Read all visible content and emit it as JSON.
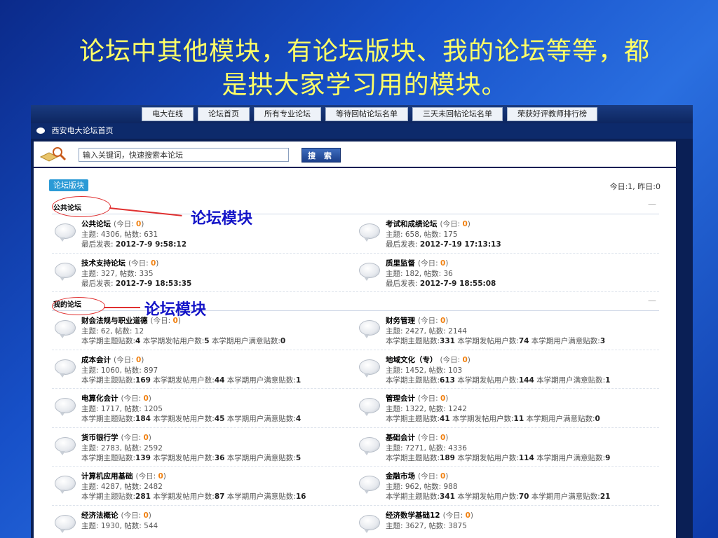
{
  "slide": {
    "title_line1": "论坛中其他模块，有论坛版块、我的论坛等等，都",
    "title_line2": "是拱大家学习用的模块。"
  },
  "nav": {
    "items": [
      "电大在线",
      "论坛首页",
      "所有专业论坛",
      "等待回帖论坛名单",
      "三天未回帖论坛名单",
      "荣获好评教师排行榜"
    ]
  },
  "breadcrumb": "西安电大论坛首页",
  "search": {
    "value": "输入关键词，快速搜索本论坛",
    "button": "搜 索",
    "icon": "magnifier-book-icon"
  },
  "header": {
    "tag": "论坛版块",
    "stats": "今日:1, 昨日:0"
  },
  "annotation": {
    "label1": "论坛模块",
    "label2": "论坛模块",
    "color": "#e03030",
    "text_color": "#1515c8"
  },
  "sections": [
    {
      "name": "公共论坛",
      "collapse": "—",
      "forums": [
        {
          "name": "公共论坛",
          "today_label": "(今日:",
          "today": "0",
          "close": ")",
          "stats": "主题: 4306, 帖数: 631",
          "extra_label": "最后发表: ",
          "extra_value": "2012-7-9 9:58:12"
        },
        {
          "name": "考试和成绩论坛",
          "today_label": "(今日:",
          "today": "0",
          "close": ")",
          "stats": "主题: 658, 帖数: 175",
          "extra_label": "最后发表: ",
          "extra_value": "2012-7-19 17:13:13"
        },
        {
          "name": "技术支持论坛",
          "today_label": "(今日:",
          "today": "0",
          "close": ")",
          "stats": "主题: 327, 帖数: 335",
          "extra_label": "最后发表: ",
          "extra_value": "2012-7-9 18:53:35"
        },
        {
          "name": "质里监督",
          "today_label": "(今日:",
          "today": "0",
          "close": ")",
          "stats": "主题: 182, 帖数: 36",
          "extra_label": "最后发表: ",
          "extra_value": "2012-7-9 18:55:08"
        }
      ]
    },
    {
      "name": "我的论坛",
      "collapse": "—",
      "forums": [
        {
          "name": "财会法规与职业道德",
          "today_label": "(今日:",
          "today": "0",
          "close": ")",
          "stats": "主题: 62, 帖数: 12",
          "extra": "本学期主题贴数:<b>4</b> 本学期发帖用户数:<b>5</b> 本学期用户满意贴数:<b>0</b>"
        },
        {
          "name": "财务管理",
          "today_label": "(今日:",
          "today": "0",
          "close": ")",
          "stats": "主题: 2427, 帖数: 2144",
          "extra": "本学期主题贴数:<b>331</b> 本学期发帖用户数:<b>74</b> 本学期用户满意贴数:<b>3</b>"
        },
        {
          "name": "成本会计",
          "today_label": "(今日:",
          "today": "0",
          "close": ")",
          "stats": "主题: 1060, 帖数: 897",
          "extra": "本学期主题贴数:<b>169</b> 本学期发帖用户数:<b>44</b> 本学期用户满意贴数:<b>1</b>"
        },
        {
          "name": "地域文化（专）",
          "today_label": "(今日:",
          "today": "0",
          "close": ")",
          "stats": "主题: 1452, 帖数: 103",
          "extra": "本学期主题贴数:<b>613</b> 本学期发帖用户数:<b>144</b> 本学期用户满意贴数:<b>1</b>"
        },
        {
          "name": "电算化会计",
          "today_label": "(今日:",
          "today": "0",
          "close": ")",
          "stats": "主题: 1717, 帖数: 1205",
          "extra": "本学期主题贴数:<b>184</b> 本学期发帖用户数:<b>45</b> 本学期用户满意贴数:<b>4</b>"
        },
        {
          "name": "管理会计",
          "today_label": "(今日:",
          "today": "0",
          "close": ")",
          "stats": "主题: 1322, 帖数: 1242",
          "extra": "本学期主题贴数:<b>41</b> 本学期发帖用户数:<b>11</b> 本学期用户满意贴数:<b>0</b>"
        },
        {
          "name": "货币银行学",
          "today_label": "(今日:",
          "today": "0",
          "close": ")",
          "stats": "主题: 2783, 帖数: 2592",
          "extra": "本学期主题贴数:<b>139</b> 本学期发帖用户数:<b>36</b> 本学期用户满意贴数:<b>5</b>"
        },
        {
          "name": "基础会计",
          "today_label": "(今日:",
          "today": "0",
          "close": ")",
          "stats": "主题: 7271, 帖数: 4336",
          "extra": "本学期主题贴数:<b>189</b> 本学期发帖用户数:<b>114</b> 本学期用户满意贴数:<b>9</b>"
        },
        {
          "name": "计算机应用基础",
          "today_label": "(今日:",
          "today": "0",
          "close": ")",
          "stats": "主题: 4287, 帖数: 2482",
          "extra": "本学期主题贴数:<b>281</b> 本学期发帖用户数:<b>87</b> 本学期用户满意贴数:<b>16</b>"
        },
        {
          "name": "金融市场",
          "today_label": "(今日:",
          "today": "0",
          "close": ")",
          "stats": "主题: 962, 帖数: 988",
          "extra": "本学期主题贴数:<b>341</b> 本学期发帖用户数:<b>70</b> 本学期用户满意贴数:<b>21</b>"
        },
        {
          "name": "经济法概论",
          "today_label": "(今日:",
          "today": "0",
          "close": ")",
          "stats": "主题: 1930, 帖数: 544",
          "extra": ""
        },
        {
          "name": "经济数学基础12",
          "today_label": "(今日:",
          "today": "0",
          "close": ")",
          "stats": "主题: 3627, 帖数: 3875",
          "extra": ""
        }
      ]
    }
  ]
}
